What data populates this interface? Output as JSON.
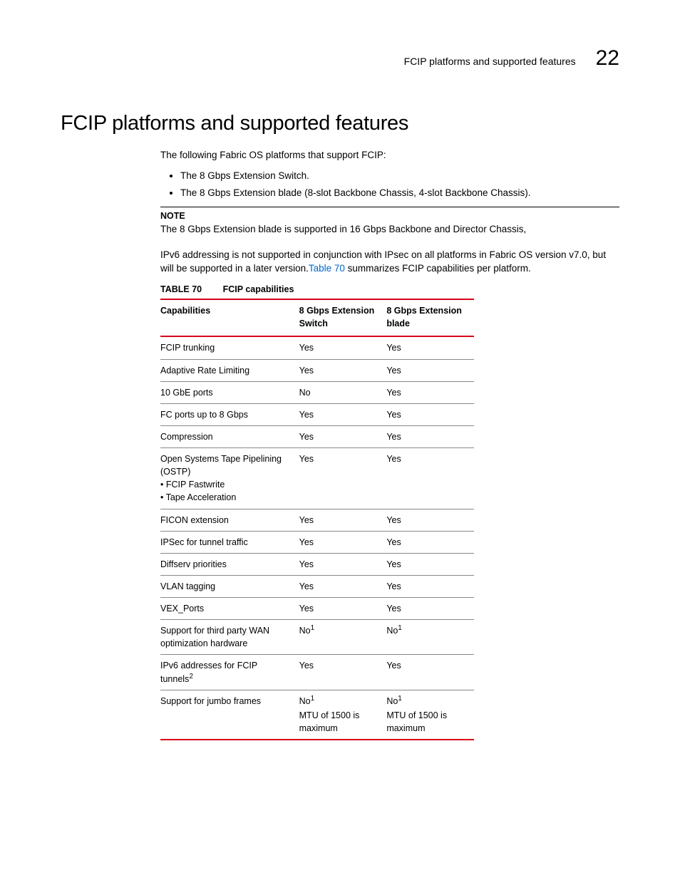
{
  "header": {
    "title": "FCIP platforms and supported features",
    "chapter": "22"
  },
  "h1": "FCIP platforms and supported features",
  "intro": "The following Fabric OS platforms that support FCIP:",
  "bullets": [
    "The 8 Gbps Extension Switch.",
    "The 8 Gbps Extension blade (8-slot Backbone Chassis, 4-slot Backbone Chassis)."
  ],
  "note": {
    "label": "NOTE",
    "body": "The 8 Gbps Extension blade is supported in 16 Gbps Backbone and Director Chassis,"
  },
  "para_pre": "IPv6 addressing is not supported in conjunction with IPsec on all platforms in Fabric OS version v7.0, but will be supported in a later version.",
  "para_link": "Table 70",
  "para_post": " summarizes FCIP capabilities per platform.",
  "table": {
    "caption_num": "TABLE 70",
    "caption_text": "FCIP capabilities",
    "headers": [
      "Capabilities",
      "8 Gbps Extension Switch",
      "8 Gbps Extension blade"
    ],
    "rows": [
      {
        "c1": "FCIP trunking",
        "c2": "Yes",
        "c3": "Yes"
      },
      {
        "c1": "Adaptive Rate Limiting",
        "c2": "Yes",
        "c3": "Yes"
      },
      {
        "c1": "10 GbE ports",
        "c2": "No",
        "c3": "Yes"
      },
      {
        "c1": "FC ports up to 8 Gbps",
        "c2": "Yes",
        "c3": "Yes"
      },
      {
        "c1": "Compression",
        "c2": "Yes",
        "c3": "Yes"
      },
      {
        "c1_html": "Open Systems Tape Pipelining (OSTP)<br>• FCIP Fastwrite<br>• Tape Acceleration",
        "c2": "Yes",
        "c3": "Yes"
      },
      {
        "c1": "FICON extension",
        "c2": "Yes",
        "c3": "Yes"
      },
      {
        "c1": "IPSec for tunnel traffic",
        "c2": "Yes",
        "c3": "Yes"
      },
      {
        "c1": "Diffserv priorities",
        "c2": "Yes",
        "c3": "Yes"
      },
      {
        "c1": "VLAN tagging",
        "c2": "Yes",
        "c3": "Yes"
      },
      {
        "c1": "VEX_Ports",
        "c2": "Yes",
        "c3": "Yes"
      },
      {
        "c1": "Support for third party WAN optimization hardware",
        "c2_html": "No<sup>1</sup>",
        "c3_html": "No<sup>1</sup>"
      },
      {
        "c1_html": "IPv6 addresses for FCIP tunnels<sup>2</sup>",
        "c2": "Yes",
        "c3": "Yes"
      },
      {
        "c1": "Support for jumbo frames",
        "c2_html": "No<sup>1</sup><div class='cell-sub'>MTU of 1500 is maximum</div>",
        "c3_html": "No<sup>1</sup><div class='cell-sub'>MTU of 1500 is maximum</div>",
        "last": true
      }
    ]
  }
}
